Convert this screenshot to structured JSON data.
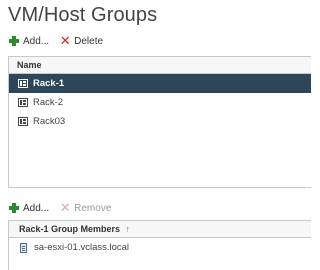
{
  "page": {
    "title": "VM/Host Groups"
  },
  "groups_toolbar": {
    "add_label": "Add...",
    "delete_label": "Delete"
  },
  "groups_table": {
    "column_header": "Name",
    "rows": [
      {
        "label": "Rack-1",
        "selected": true
      },
      {
        "label": "Rack-2",
        "selected": false
      },
      {
        "label": "Rack03",
        "selected": false
      }
    ]
  },
  "members_toolbar": {
    "add_label": "Add...",
    "remove_label": "Remove"
  },
  "members_table": {
    "column_header": "Rack-1 Group Members",
    "sort_indicator": "↑",
    "rows": [
      {
        "label": "sa-esxi-01.vclass.local"
      }
    ]
  },
  "colors": {
    "selection": "#2d4659",
    "add_green": "#2e8b2e",
    "delete_red": "#d9252e"
  },
  "icons": [
    "plus-icon",
    "delete-x-icon",
    "rack-group-icon",
    "host-icon",
    "sort-up-icon"
  ]
}
